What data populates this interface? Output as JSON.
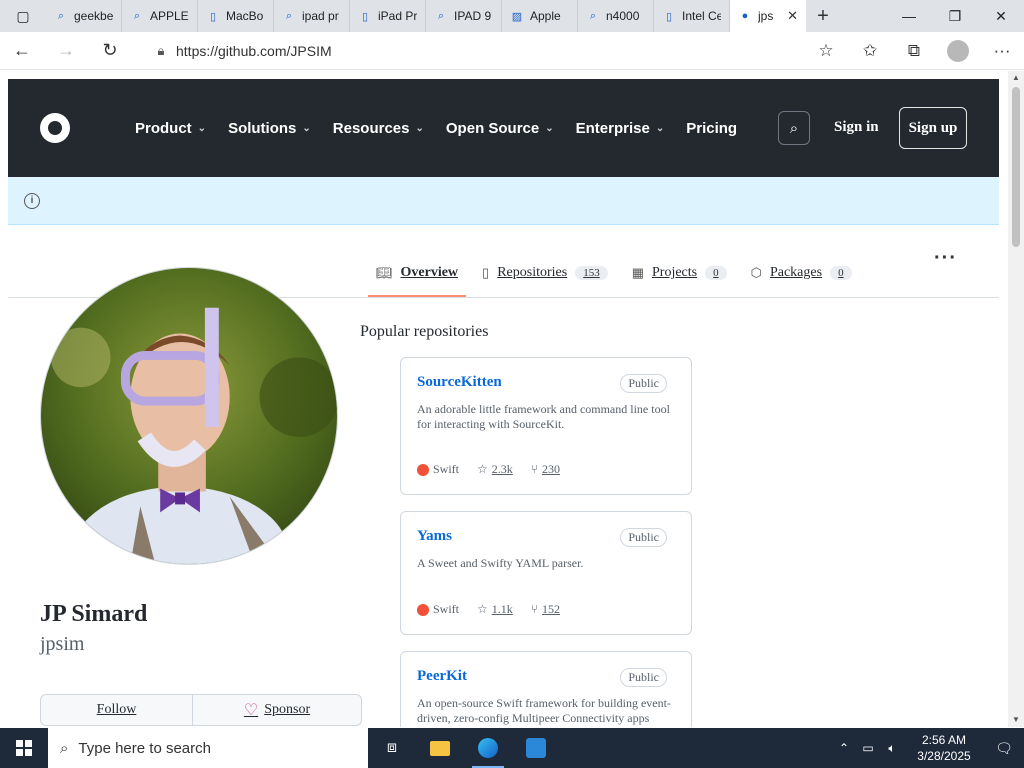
{
  "browser": {
    "tabs": [
      {
        "label": "geekbe",
        "icon": "search-icon"
      },
      {
        "label": "APPLE",
        "icon": "search-icon"
      },
      {
        "label": "MacBo",
        "icon": "page-icon"
      },
      {
        "label": "ipad pr",
        "icon": "search-icon"
      },
      {
        "label": "iPad Pr",
        "icon": "page-icon"
      },
      {
        "label": "IPAD 9",
        "icon": "search-icon"
      },
      {
        "label": "Apple",
        "icon": "image-icon"
      },
      {
        "label": "n4000",
        "icon": "search-icon"
      },
      {
        "label": "Intel Ce",
        "icon": "page-icon"
      },
      {
        "label": "jps",
        "icon": "github-icon",
        "active": true
      }
    ],
    "url": "https://github.com/JPSIM"
  },
  "header": {
    "nav": [
      "Product",
      "Solutions",
      "Resources",
      "Open Source",
      "Enterprise",
      "Pricing"
    ],
    "sign_in": "Sign in",
    "sign_up": "Sign up"
  },
  "profile_tabs": [
    {
      "label": "Overview",
      "count": null,
      "icon": "book-icon",
      "active": true
    },
    {
      "label": "Repositories",
      "count": "153",
      "icon": "repo-icon"
    },
    {
      "label": "Projects",
      "count": "0",
      "icon": "table-icon"
    },
    {
      "label": "Packages",
      "count": "0",
      "icon": "package-icon"
    }
  ],
  "profile": {
    "name": "JP Simard",
    "login": "jpsim",
    "follow": "Follow",
    "sponsor": "Sponsor"
  },
  "popular": {
    "title": "Popular repositories",
    "repos": [
      {
        "name": "SourceKitten",
        "visibility": "Public",
        "description": "An adorable little framework and command line tool for interacting with SourceKit.",
        "language": "Swift",
        "stars": "2.3k",
        "forks": "230"
      },
      {
        "name": "Yams",
        "visibility": "Public",
        "description": "A Sweet and Swifty YAML parser.",
        "language": "Swift",
        "stars": "1.1k",
        "forks": "152"
      },
      {
        "name": "PeerKit",
        "visibility": "Public",
        "description": "An open-source Swift framework for building event-driven, zero-config Multipeer Connectivity apps",
        "language": "",
        "stars": "",
        "forks": ""
      }
    ]
  },
  "taskbar": {
    "search_placeholder": "Type here to search",
    "time": "2:56 AM",
    "date": "3/28/2025"
  },
  "colors": {
    "header_bg": "#24292f",
    "banner_bg": "#ddf4ff",
    "link": "#0969da",
    "swift": "#f05138",
    "tab_underline": "#fd8c73"
  }
}
